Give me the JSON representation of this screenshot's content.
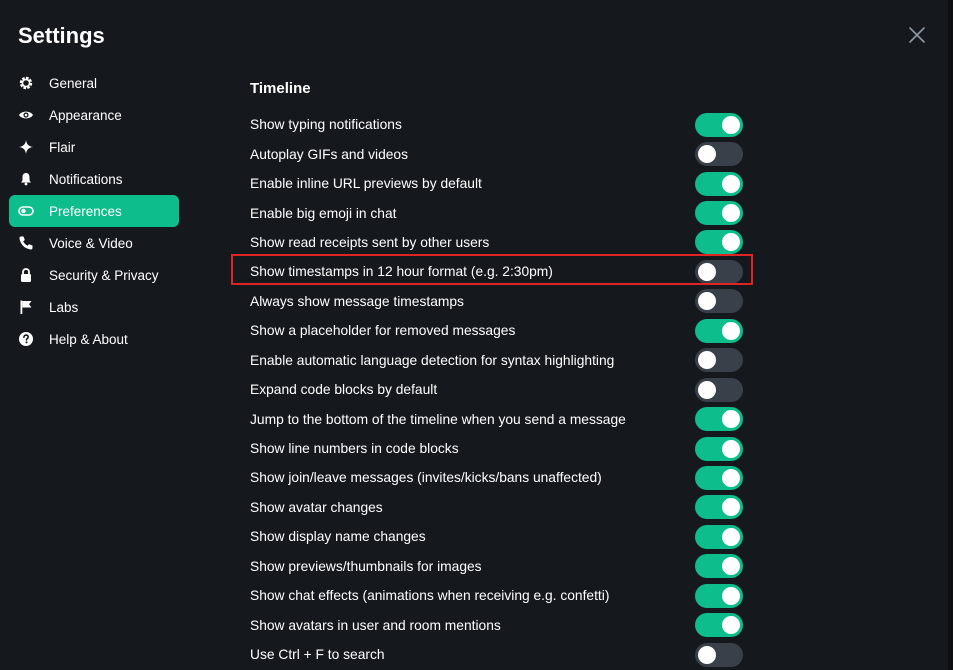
{
  "dialog": {
    "title": "Settings"
  },
  "sidebar": {
    "items": [
      {
        "id": "general",
        "label": "General",
        "icon": "gear-icon",
        "active": false
      },
      {
        "id": "appearance",
        "label": "Appearance",
        "icon": "eye-icon",
        "active": false
      },
      {
        "id": "flair",
        "label": "Flair",
        "icon": "sparkle-icon",
        "active": false
      },
      {
        "id": "notifications",
        "label": "Notifications",
        "icon": "bell-icon",
        "active": false
      },
      {
        "id": "preferences",
        "label": "Preferences",
        "icon": "toggle-icon",
        "active": true
      },
      {
        "id": "voice-video",
        "label": "Voice & Video",
        "icon": "phone-icon",
        "active": false
      },
      {
        "id": "security-privacy",
        "label": "Security & Privacy",
        "icon": "lock-icon",
        "active": false
      },
      {
        "id": "labs",
        "label": "Labs",
        "icon": "flag-icon",
        "active": false
      },
      {
        "id": "help-about",
        "label": "Help & About",
        "icon": "help-circle-icon",
        "active": false
      }
    ]
  },
  "timeline": {
    "heading": "Timeline",
    "settings": [
      {
        "label": "Show typing notifications",
        "enabled": true
      },
      {
        "label": "Autoplay GIFs and videos",
        "enabled": false
      },
      {
        "label": "Enable inline URL previews by default",
        "enabled": true
      },
      {
        "label": "Enable big emoji in chat",
        "enabled": true
      },
      {
        "label": "Show read receipts sent by other users",
        "enabled": true
      },
      {
        "label": "Show timestamps in 12 hour format (e.g. 2:30pm)",
        "enabled": false,
        "highlighted": true
      },
      {
        "label": "Always show message timestamps",
        "enabled": false
      },
      {
        "label": "Show a placeholder for removed messages",
        "enabled": true
      },
      {
        "label": "Enable automatic language detection for syntax highlighting",
        "enabled": false
      },
      {
        "label": "Expand code blocks by default",
        "enabled": false
      },
      {
        "label": "Jump to the bottom of the timeline when you send a message",
        "enabled": true
      },
      {
        "label": "Show line numbers in code blocks",
        "enabled": true
      },
      {
        "label": "Show join/leave messages (invites/kicks/bans unaffected)",
        "enabled": true
      },
      {
        "label": "Show avatar changes",
        "enabled": true
      },
      {
        "label": "Show display name changes",
        "enabled": true
      },
      {
        "label": "Show previews/thumbnails for images",
        "enabled": true
      },
      {
        "label": "Show chat effects (animations when receiving e.g. confetti)",
        "enabled": true
      },
      {
        "label": "Show avatars in user and room mentions",
        "enabled": true
      },
      {
        "label": "Use Ctrl + F to search",
        "enabled": false
      }
    ]
  },
  "colors": {
    "background": "#15191e",
    "accent": "#0dbd8b",
    "toggle_off": "#394049",
    "highlight": "#e02424"
  }
}
